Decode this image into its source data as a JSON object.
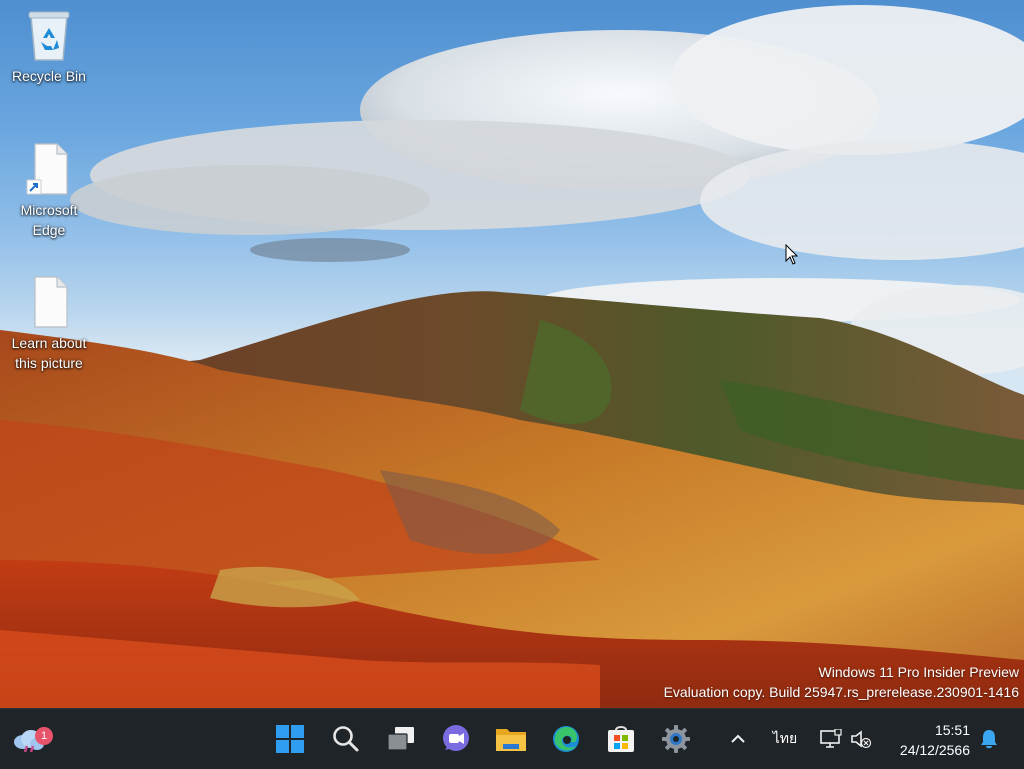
{
  "desktop": {
    "icons": [
      {
        "label": "Recycle Bin",
        "icon": "recycle-bin-icon"
      },
      {
        "label": "Microsoft Edge",
        "icon": "edge-shortcut-icon"
      },
      {
        "label": "Learn about this picture",
        "icon": "document-icon"
      }
    ],
    "watermark": {
      "line1": "Windows 11 Pro Insider Preview",
      "line2": "Evaluation copy. Build 25947.rs_prerelease.230901-1416"
    }
  },
  "taskbar": {
    "weather": {
      "icon": "weather-cloud-icon",
      "badge": "1"
    },
    "apps": [
      {
        "name": "Start",
        "icon": "windows-start-icon"
      },
      {
        "name": "Search",
        "icon": "search-icon"
      },
      {
        "name": "Task View",
        "icon": "task-view-icon"
      },
      {
        "name": "Teams",
        "icon": "teams-chat-icon"
      },
      {
        "name": "File Explorer",
        "icon": "file-explorer-icon"
      },
      {
        "name": "Microsoft Edge",
        "icon": "edge-icon"
      },
      {
        "name": "Microsoft Store",
        "icon": "store-icon"
      },
      {
        "name": "Settings",
        "icon": "settings-gear-icon"
      }
    ],
    "tray": {
      "overflow_icon": "chevron-up-icon",
      "language": "ไทย",
      "network_icon": "network-icon",
      "volume_icon": "volume-muted-icon",
      "time": "15:51",
      "date": "24/12/2566",
      "notification_icon": "bell-icon"
    }
  },
  "colors": {
    "taskbar_bg": "#1f2428",
    "accent_blue": "#2f8fe0"
  }
}
